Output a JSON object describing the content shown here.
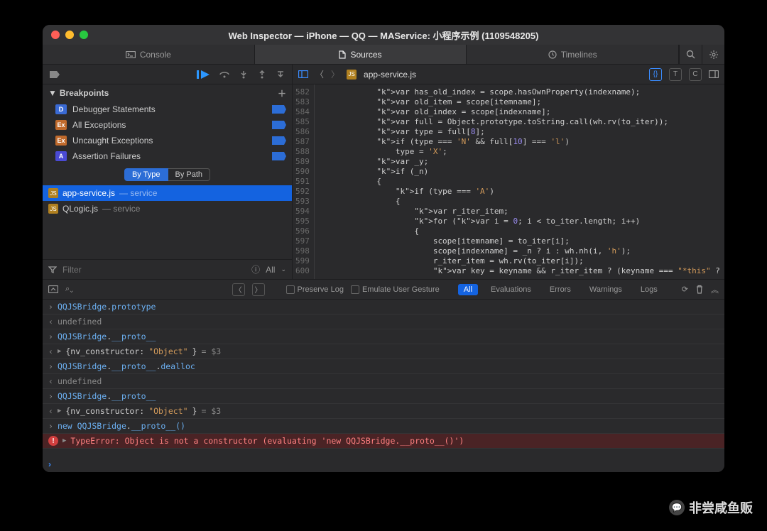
{
  "title": "Web Inspector — iPhone — QQ — MAService: 小程序示例 (1109548205)",
  "tabs": {
    "console": "Console",
    "sources": "Sources",
    "timelines": "Timelines"
  },
  "sidebar": {
    "breakpoints_label": "Breakpoints",
    "items": [
      {
        "badge": "D",
        "label": "Debugger Statements"
      },
      {
        "badge": "Ex",
        "label": "All Exceptions"
      },
      {
        "badge": "Ex",
        "label": "Uncaught Exceptions"
      },
      {
        "badge": "A",
        "label": "Assertion Failures"
      }
    ],
    "seg": {
      "by_type": "By Type",
      "by_path": "By Path"
    },
    "sources": [
      {
        "name": "app-service.js",
        "scope": "— service",
        "sel": true
      },
      {
        "name": "QLogic.js",
        "scope": "— service",
        "sel": false
      }
    ],
    "filter_placeholder": "Filter",
    "all_label": "All"
  },
  "editor": {
    "file": "app-service.js",
    "lines_start": 582,
    "lines": [
      "            var has_old_index = scope.hasOwnProperty(indexname);",
      "            var old_item = scope[itemname];",
      "            var old_index = scope[indexname];",
      "            var full = Object.prototype.toString.call(wh.rv(to_iter));",
      "            var type = full[8];",
      "            if (type === 'N' && full[10] === 'l')",
      "                type = 'X';",
      "            var _y;",
      "            if (_n)",
      "            {",
      "                if (type === 'A')",
      "                {",
      "                    var r_iter_item;",
      "                    for (var i = 0; i < to_iter.length; i++)",
      "                    {",
      "                        scope[itemname] = to_iter[i];",
      "                        scope[indexname] = _n ? i : wh.nh(i, 'h');",
      "                        r_iter_item = wh.rv(to_iter[i]);",
      "                        var key = keyname && r_iter_item ? (keyname === \"*this\" ?"
    ]
  },
  "console_bar": {
    "preserve": "Preserve Log",
    "emulate": "Emulate User Gesture",
    "filters": {
      "all": "All",
      "eval": "Evaluations",
      "err": "Errors",
      "warn": "Warnings",
      "logs": "Logs"
    }
  },
  "console_rows": [
    {
      "t": "in",
      "text": "QQJSBridge.prototype"
    },
    {
      "t": "out",
      "text": "undefined"
    },
    {
      "t": "in",
      "text": "QQJSBridge.__proto__"
    },
    {
      "t": "obj",
      "text": "{nv_constructor: \"Object\"}",
      "suffix": " = $3"
    },
    {
      "t": "in",
      "text": "QQJSBridge.__proto__.dealloc"
    },
    {
      "t": "out",
      "text": "undefined"
    },
    {
      "t": "in",
      "text": "QQJSBridge.__proto__"
    },
    {
      "t": "obj",
      "text": "{nv_constructor: \"Object\"}",
      "suffix": " = $3"
    },
    {
      "t": "in",
      "text": "new QQJSBridge.__proto__()"
    },
    {
      "t": "err",
      "text": "TypeError: Object is not a constructor (evaluating 'new QQJSBridge.__proto__()')"
    }
  ],
  "watermark": "非尝咸鱼贩"
}
